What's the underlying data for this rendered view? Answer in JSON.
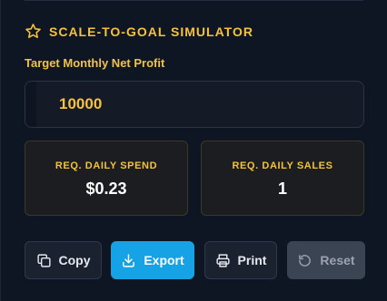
{
  "header": {
    "title": "SCALE-TO-GOAL SIMULATOR",
    "icon": "star-icon"
  },
  "target_input": {
    "label": "Target Monthly Net Profit",
    "value": "10000"
  },
  "stats": {
    "daily_spend": {
      "label": "REQ. DAILY SPEND",
      "value": "$0.23"
    },
    "daily_sales": {
      "label": "REQ. DAILY SALES",
      "value": "1"
    }
  },
  "actions": {
    "copy": {
      "label": "Copy",
      "icon": "copy-icon"
    },
    "export": {
      "label": "Export",
      "icon": "download-icon"
    },
    "print": {
      "label": "Print",
      "icon": "printer-icon"
    },
    "reset": {
      "label": "Reset",
      "icon": "reset-icon",
      "disabled": true
    }
  },
  "colors": {
    "accent": "#f6c23c",
    "primary_button": "#16a3e6",
    "background": "#0f1623"
  }
}
